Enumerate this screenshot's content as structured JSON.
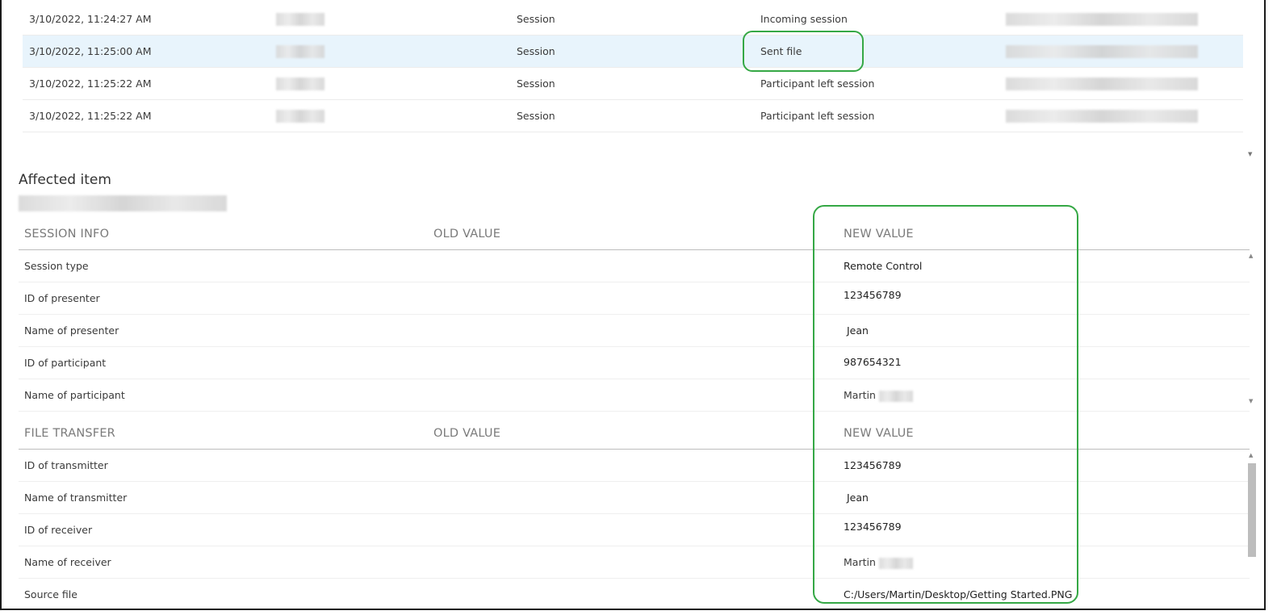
{
  "events": [
    {
      "date": "3/10/2022, 11:24:27 AM",
      "category": "Session",
      "action": "Incoming session",
      "selected": false
    },
    {
      "date": "3/10/2022, 11:25:00 AM",
      "category": "Session",
      "action": "Sent file",
      "selected": true
    },
    {
      "date": "3/10/2022, 11:25:22 AM",
      "category": "Session",
      "action": "Participant left session",
      "selected": false
    },
    {
      "date": "3/10/2022, 11:25:22 AM",
      "category": "Session",
      "action": "Participant left session",
      "selected": false
    }
  ],
  "affected": {
    "title": "Affected item"
  },
  "session_info": {
    "header": "SESSION INFO",
    "old_value_label": "OLD VALUE",
    "new_value_label": "NEW VALUE",
    "rows": [
      {
        "key": "Session type",
        "value": "Remote Control"
      },
      {
        "key": "ID of presenter",
        "value": "123456789"
      },
      {
        "key": "Name of presenter",
        "value": "Jean"
      },
      {
        "key": "ID of participant",
        "value": "987654321"
      },
      {
        "key": "Name of participant",
        "value": "Martin"
      }
    ]
  },
  "file_transfer": {
    "header": "FILE TRANSFER",
    "old_value_label": "OLD VALUE",
    "new_value_label": "NEW VALUE",
    "rows": [
      {
        "key": "ID of transmitter",
        "value": "123456789"
      },
      {
        "key": "Name of transmitter",
        "value": "Jean"
      },
      {
        "key": "ID of receiver",
        "value": "123456789"
      },
      {
        "key": "Name of receiver",
        "value": "Martin"
      },
      {
        "key": "Source file",
        "value": "C:/Users/Martin/Desktop/Getting Started.PNG"
      }
    ]
  },
  "colors": {
    "highlight": "#35a845",
    "selected_row": "#e8f4fc"
  }
}
